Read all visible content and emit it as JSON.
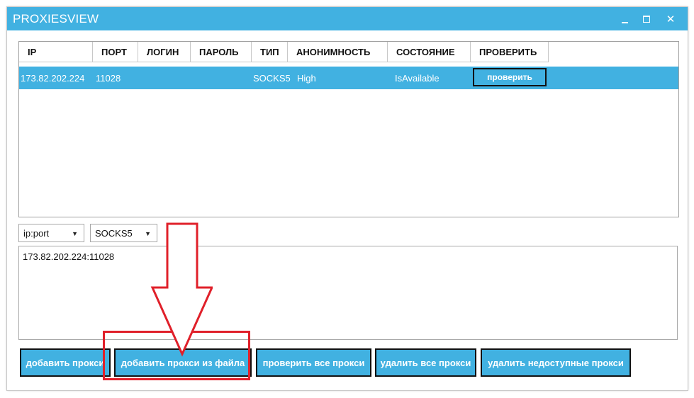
{
  "window": {
    "title": "PROXIESVIEW",
    "controls": {
      "minimize": "_",
      "maximize": "□",
      "close": "✕"
    }
  },
  "grid": {
    "columns": [
      "IP",
      "ПОРТ",
      "ЛОГИН",
      "ПАРОЛЬ",
      "ТИП",
      "АНОНИМНОСТЬ",
      "СОСТОЯНИЕ",
      "ПРОВЕРИТЬ"
    ],
    "rows": [
      {
        "ip": "173.82.202.224",
        "port": "11028",
        "login": "",
        "password": "",
        "type": "SOCKS5",
        "anonymity": "High",
        "status": "IsAvailable",
        "check_label": "проверить"
      }
    ]
  },
  "format_select": {
    "value": "ip:port"
  },
  "type_select": {
    "value": "SOCKS5"
  },
  "input_text": "173.82.202.224:11028",
  "buttons": {
    "add_proxy": "добавить прокси",
    "add_from_file": "добавить прокси из файла",
    "check_all": "проверить все прокси",
    "delete_all": "удалить все прокси",
    "delete_unavailable": "удалить недоступные прокси"
  },
  "colors": {
    "accent": "#41b1e1",
    "annotation": "#e0202a"
  }
}
